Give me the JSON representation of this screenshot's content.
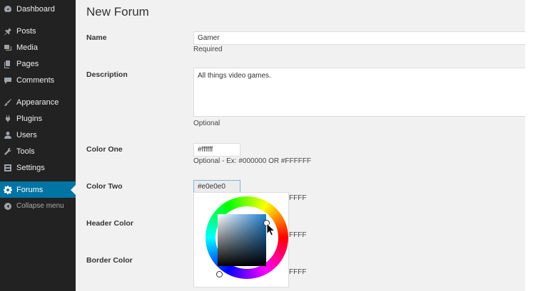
{
  "sidebar": {
    "items": [
      {
        "label": "Dashboard",
        "icon": "dashboard-icon"
      },
      {
        "label": "Posts",
        "icon": "pushpin-icon"
      },
      {
        "label": "Media",
        "icon": "media-icon"
      },
      {
        "label": "Pages",
        "icon": "pages-icon"
      },
      {
        "label": "Comments",
        "icon": "comment-icon"
      },
      {
        "label": "Appearance",
        "icon": "paintbrush-icon"
      },
      {
        "label": "Plugins",
        "icon": "plug-icon"
      },
      {
        "label": "Users",
        "icon": "user-icon"
      },
      {
        "label": "Tools",
        "icon": "wrench-icon"
      },
      {
        "label": "Settings",
        "icon": "settings-icon"
      },
      {
        "label": "Forums",
        "icon": "gear-icon",
        "active": true
      }
    ],
    "collapse_label": "Collapse menu",
    "accent_color": "#0074a2"
  },
  "page": {
    "title": "New Forum",
    "name": {
      "label": "Name",
      "value": "Gamer",
      "hint": "Required"
    },
    "description": {
      "label": "Description",
      "value": "All things video games.",
      "hint": "Optional"
    },
    "color_one": {
      "label": "Color One",
      "value": "#ffffff",
      "hint": "Optional - Ex: #000000 OR #FFFFFF"
    },
    "color_two": {
      "label": "Color Two",
      "value": "#e0e0e0",
      "hint_partial": "FFFF"
    },
    "header_color": {
      "label": "Header Color",
      "hint_partial": "FFFF"
    },
    "border_color": {
      "label": "Border Color",
      "hint_partial": "FFFF"
    }
  }
}
